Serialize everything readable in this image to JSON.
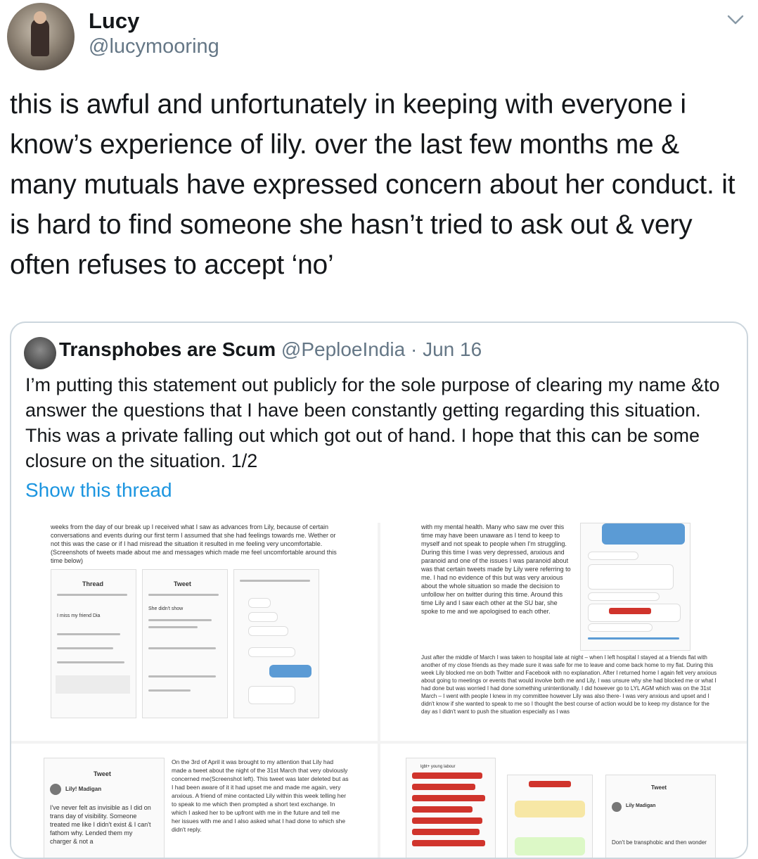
{
  "author": {
    "name": "Lucy",
    "handle": "@lucymooring"
  },
  "tweet": {
    "text": "this is awful and unfortunately in keeping with everyone i know’s experience of lily. over the last few months me & many mutuals have expressed concern about her conduct. it is hard to find someone she hasn’t tried to ask out & very often refuses to accept ‘no’"
  },
  "quote": {
    "name": "Transphobes are Scum",
    "handle": "@PeploeIndia",
    "date": "· Jun 16",
    "text": "I’m putting this statement out publicly for the sole purpose of clearing my name &to answer the questions that I have been constantly getting regarding this situation. This was a private falling out which got out of hand. I hope that this can be some closure on the situation. 1/2",
    "show_thread": "Show this thread"
  },
  "media": {
    "p1_text": "weeks from the day of our break up I received what I saw as advances from Lily, because of certain conversations and events during our first term I assumed that she had feelings towards me. Wether or not this was the case or if I had misread the situation it resulted in me feeling very uncomfortable. (Screenshots of tweets made about me and messages which made me feel uncomfortable around this time below)",
    "p2_text": "with my mental health. Many who saw me over this time may have been unaware as I tend to keep to myself and not speak to people when I'm struggling. During this time I was very depressed, anxious and paranoid and one of the issues I was paranoid about was that certain tweets made by Lily were referring to me. I had no evidence of this but was very anxious about the whole situation so made the decision to unfollow her on twitter during this time. Around this time Lily and I saw each other at the SU bar, she spoke to me and we apologised to each other.",
    "p2_text_b": "Just after the middle of March I was taken to hospital late at night – when I left hospital I stayed at a friends flat with another of my close friends as they made sure it was safe for me to leave and come back home to my flat. During this week Lily blocked me on both Twitter and Facebook with no explanation. After I returned home I again felt very anxious about going to meetings or events that would involve both me and Lily, I was unsure why she had blocked me or what I had done but was worried I had done something unintentionally. I did however go to LYL AGM which was on the 31st March – I went with people I knew in my committee however Lily was also there- I was very anxious and upset and I didn't know if she wanted to speak to me so I thought the best course of action would be to keep my distance for the day as I didn't want to push the situation especially as I was",
    "p3_text": "On the 3rd of April it was brought to my attention that Lily had made a tweet about the night of the 31st March that very obviously concerned me(Screenshot left). This tweet was later deleted but as I had been aware of it it had upset me and made me again, very anxious. A friend of mine contacted Lily within this week telling her to speak to me which then prompted a short text exchange. In which I asked her to be upfront with me in the future and tell me her issues with me and I also asked what I had done to which she didn't reply.",
    "p3_tweet_name": "Lily! Madigan",
    "p3_tweet_text": "I've never felt as invisible as I did on trans day of visibility. Someone treated me like I didn't exist & I can't fathom why. Lended them my charger & not a",
    "p3_label": "Tweet",
    "p1_thread": "Thread",
    "p1_tweet": "Tweet",
    "p1_miss": "I miss my friend Dia",
    "p1_show": "She didn't show",
    "p4_label": "Tweet",
    "p4_name": "Lily Madigan",
    "p4_text": "Don't be transphobic and then wonder",
    "p4_chat": "lgbt+ young labour"
  },
  "colors": {
    "link": "#1b95e0",
    "muted": "#657786",
    "border": "#ccd6dd"
  }
}
